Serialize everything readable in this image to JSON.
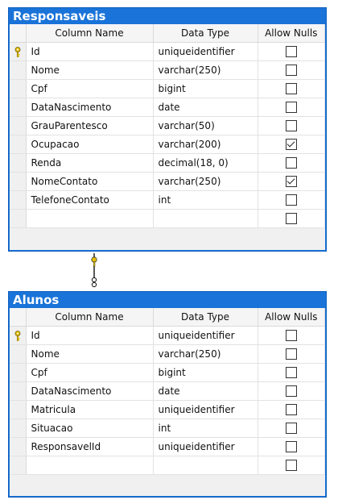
{
  "headers": {
    "column_name": "Column Name",
    "data_type": "Data Type",
    "allow_nulls": "Allow Nulls"
  },
  "tables": [
    {
      "title": "Responsaveis",
      "rows": [
        {
          "key": true,
          "name": "Id",
          "type": "uniqueidentifier",
          "nulls": false
        },
        {
          "key": false,
          "name": "Nome",
          "type": "varchar(250)",
          "nulls": false
        },
        {
          "key": false,
          "name": "Cpf",
          "type": "bigint",
          "nulls": false
        },
        {
          "key": false,
          "name": "DataNascimento",
          "type": "date",
          "nulls": false
        },
        {
          "key": false,
          "name": "GrauParentesco",
          "type": "varchar(50)",
          "nulls": false
        },
        {
          "key": false,
          "name": "Ocupacao",
          "type": "varchar(200)",
          "nulls": true
        },
        {
          "key": false,
          "name": "Renda",
          "type": "decimal(18, 0)",
          "nulls": false
        },
        {
          "key": false,
          "name": "NomeContato",
          "type": "varchar(250)",
          "nulls": true
        },
        {
          "key": false,
          "name": "TelefoneContato",
          "type": "int",
          "nulls": false
        },
        {
          "key": false,
          "name": "",
          "type": "",
          "nulls": false
        }
      ]
    },
    {
      "title": "Alunos",
      "rows": [
        {
          "key": true,
          "name": "Id",
          "type": "uniqueidentifier",
          "nulls": false
        },
        {
          "key": false,
          "name": "Nome",
          "type": "varchar(250)",
          "nulls": false
        },
        {
          "key": false,
          "name": "Cpf",
          "type": "bigint",
          "nulls": false
        },
        {
          "key": false,
          "name": "DataNascimento",
          "type": "date",
          "nulls": false
        },
        {
          "key": false,
          "name": "Matricula",
          "type": "uniqueidentifier",
          "nulls": false
        },
        {
          "key": false,
          "name": "Situacao",
          "type": "int",
          "nulls": false
        },
        {
          "key": false,
          "name": "ResponsavelId",
          "type": "uniqueidentifier",
          "nulls": false
        },
        {
          "key": false,
          "name": "",
          "type": "",
          "nulls": false
        }
      ]
    }
  ],
  "relationship": {
    "from": "Alunos.ResponsavelId",
    "to": "Responsaveis.Id",
    "one_end_icon": "key-icon",
    "many_end_icon": "infinity-icon"
  },
  "colors": {
    "title_bar": "#1a73d8",
    "key": "#e8c000"
  }
}
